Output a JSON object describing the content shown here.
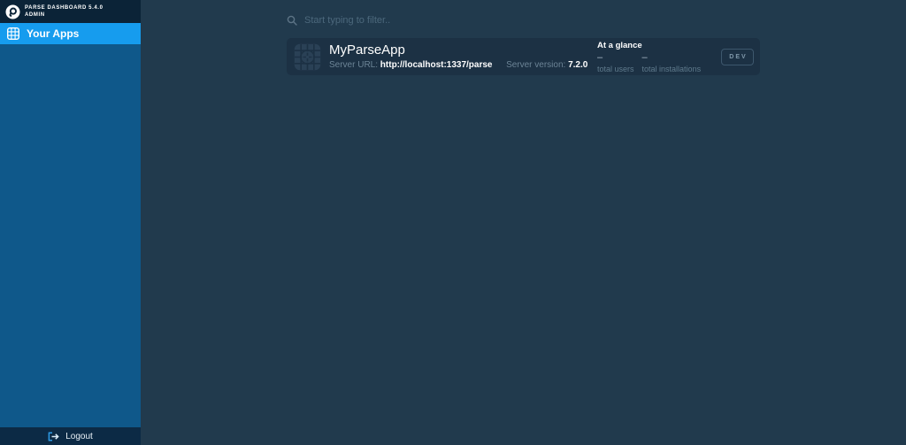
{
  "brand": {
    "line1": "PARSE DASHBOARD 5.4.0",
    "line2": "ADMIN"
  },
  "sidebar": {
    "items": [
      {
        "label": "Your Apps",
        "icon": "apps-grid-icon",
        "selected": true
      }
    ],
    "logout_label": "Logout",
    "logout_icon": "logout-icon"
  },
  "search": {
    "placeholder": "Start typing to filter..",
    "icon": "search-icon"
  },
  "apps": [
    {
      "name": "MyParseApp",
      "icon": "app-blueprint-icon",
      "server_url_label": "Server URL:",
      "server_url": "http://localhost:1337/parse",
      "server_version_label": "Server version:",
      "server_version": "7.2.0",
      "glance_title": "At a glance",
      "stats": [
        {
          "value": "–",
          "label": "total users"
        },
        {
          "value": "–",
          "label": "total installations"
        }
      ],
      "env_button_label": "DEV"
    }
  ],
  "colors": {
    "accent_blue": "#169CEE",
    "sidebar_blue": "#0F588A",
    "sidebar_header_navy": "#0B2337",
    "logout_bar_navy": "#0C2A45",
    "main_background": "#213A4D",
    "card_background": "#1C3144",
    "muted_text": "#6C8496"
  }
}
